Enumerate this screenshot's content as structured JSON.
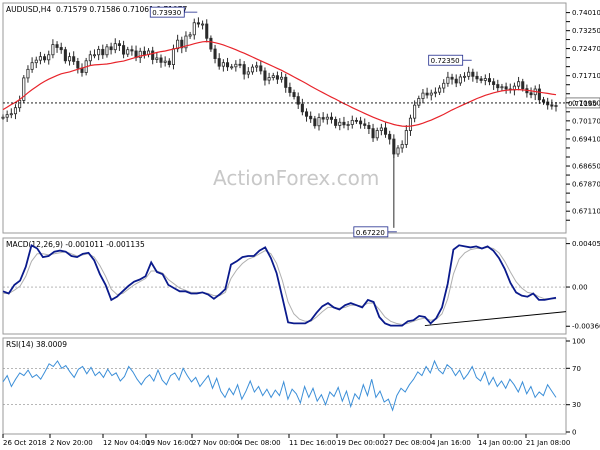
{
  "header": {
    "symbol": "AUDUSD,H4",
    "ohlc": "0.71579 0.71586 0.71061 0.71077"
  },
  "watermark": "ActionForex.com",
  "colors": {
    "candle": "#2b2b2b",
    "ma": "#e8242b",
    "macd": "#0a1a8c",
    "signal": "#b0b0b0",
    "rsi": "#3c8fd8",
    "grid": "#8c8c8c"
  },
  "chart_data": [
    {
      "type": "candlestick",
      "name": "price",
      "title": "AUDUSD,H4",
      "ylim": [
        0.6712,
        0.7425
      ],
      "y_ticks": [
        0.7401,
        0.73725,
        0.7344,
        0.7316,
        0.72875,
        0.7259,
        0.72305,
        0.7202,
        0.71735,
        0.7145,
        0.71165,
        0.7088,
        0.70595,
        0.7031,
        0.70025,
        0.6974,
        0.69455,
        0.6917,
        0.68885,
        0.686,
        0.68315,
        0.6803,
        0.67745,
        0.6746
      ],
      "y_tick_labels": [
        "0.74010",
        "",
        "0.73250",
        "",
        "0.72470",
        "",
        "",
        "0.71710",
        "",
        "",
        "0.70950",
        "",
        "0.70170",
        "",
        "0.69410",
        "",
        "",
        "0.68650",
        "",
        "0.67870",
        "",
        "",
        "0.67110"
      ],
      "current_price": 0.7116,
      "current_price_label": "0.71160",
      "annotations": [
        {
          "label": "0.73930",
          "value": 0.7393
        },
        {
          "label": "0.72350",
          "value": 0.7235
        },
        {
          "label": "0.67220",
          "value": 0.6722
        }
      ],
      "close_path": [
        0.7071,
        0.7079,
        0.7082,
        0.7101,
        0.7124,
        0.7195,
        0.7222,
        0.7243,
        0.7251,
        0.7262,
        0.7252,
        0.7268,
        0.73,
        0.7291,
        0.7284,
        0.7249,
        0.7262,
        0.7247,
        0.7226,
        0.7212,
        0.7249,
        0.7268,
        0.7268,
        0.7285,
        0.7268,
        0.7293,
        0.7284,
        0.7303,
        0.7297,
        0.727,
        0.7284,
        0.728,
        0.7259,
        0.7279,
        0.7269,
        0.728,
        0.7253,
        0.7258,
        0.7244,
        0.7248,
        0.7237,
        0.7287,
        0.7314,
        0.729,
        0.7327,
        0.7331,
        0.7369,
        0.7365,
        0.7365,
        0.732,
        0.7286,
        0.7256,
        0.7232,
        0.7243,
        0.723,
        0.723,
        0.7238,
        0.7237,
        0.7207,
        0.7214,
        0.7229,
        0.7233,
        0.7217,
        0.7188,
        0.7196,
        0.7202,
        0.7191,
        0.7197,
        0.7165,
        0.7149,
        0.7136,
        0.7112,
        0.7088,
        0.7074,
        0.7066,
        0.7044,
        0.707,
        0.7065,
        0.7071,
        0.7064,
        0.7045,
        0.7055,
        0.7047,
        0.7048,
        0.7061,
        0.7059,
        0.705,
        0.7045,
        0.7035,
        0.7006,
        0.7029,
        0.7037,
        0.7017,
        0.7002,
        0.6955,
        0.6974,
        0.6985,
        0.7029,
        0.7068,
        0.7109,
        0.713,
        0.7147,
        0.7141,
        0.7147,
        0.715,
        0.7163,
        0.7178,
        0.7197,
        0.7191,
        0.7179,
        0.7198,
        0.72,
        0.7213,
        0.72,
        0.7192,
        0.7187,
        0.7193,
        0.7183,
        0.7174,
        0.7164,
        0.7167,
        0.716,
        0.7157,
        0.7169,
        0.7183,
        0.7161,
        0.7148,
        0.7142,
        0.716,
        0.7126,
        0.7119,
        0.711,
        0.7106,
        0.7108
      ],
      "ma_path": [
        0.7095,
        0.7103,
        0.7111,
        0.7118,
        0.7127,
        0.7137,
        0.7148,
        0.7158,
        0.7167,
        0.7176,
        0.7184,
        0.7191,
        0.7197,
        0.7203,
        0.7208,
        0.7211,
        0.7214,
        0.7218,
        0.7222,
        0.7226,
        0.723,
        0.7234,
        0.7236,
        0.7237,
        0.7238,
        0.7239,
        0.7241,
        0.7244,
        0.7246,
        0.7248,
        0.7252,
        0.7256,
        0.726,
        0.7264,
        0.7266,
        0.7269,
        0.7272,
        0.7275,
        0.7278,
        0.728,
        0.7283,
        0.7286,
        0.7289,
        0.7292,
        0.7296,
        0.7299,
        0.7303,
        0.7306,
        0.7309,
        0.731,
        0.7309,
        0.7306,
        0.7303,
        0.7299,
        0.7294,
        0.7289,
        0.7284,
        0.7278,
        0.7273,
        0.7267,
        0.7261,
        0.7255,
        0.7249,
        0.7243,
        0.7237,
        0.7231,
        0.7225,
        0.7219,
        0.7212,
        0.7205,
        0.7198,
        0.7191,
        0.7184,
        0.7177,
        0.7169,
        0.7162,
        0.7155,
        0.7148,
        0.7141,
        0.7134,
        0.7128,
        0.7121,
        0.7114,
        0.7108,
        0.7101,
        0.7095,
        0.7089,
        0.7083,
        0.7077,
        0.7071,
        0.7066,
        0.7061,
        0.7056,
        0.7052,
        0.7048,
        0.7045,
        0.7043,
        0.7042,
        0.7043,
        0.7045,
        0.7048,
        0.7052,
        0.7057,
        0.7062,
        0.7068,
        0.7074,
        0.708,
        0.7087,
        0.7094,
        0.71,
        0.7106,
        0.7112,
        0.7118,
        0.7124,
        0.713,
        0.7135,
        0.714,
        0.7144,
        0.7148,
        0.7151,
        0.7154,
        0.7156,
        0.7157,
        0.7158,
        0.7158,
        0.7157,
        0.7156,
        0.7154,
        0.7152,
        0.715,
        0.7148,
        0.7146,
        0.7144,
        0.7142
      ],
      "spike_low": 0.6722
    },
    {
      "type": "line",
      "name": "macd",
      "title": "MACD(12,26,9) -0.001011 -0.001135",
      "ylim": [
        -0.0042,
        0.0043
      ],
      "y_ticks": [
        0.004055,
        0.0,
        -0.003662
      ],
      "y_tick_labels": [
        "0.004055",
        "0.00",
        "-0.003662"
      ],
      "series": [
        {
          "name": "MACD",
          "values": [
            -0.0004,
            -0.0006,
            0.0002,
            0.0006,
            0.0019,
            0.0039,
            0.0036,
            0.0028,
            0.0029,
            0.0033,
            0.0034,
            0.0033,
            0.0029,
            0.0028,
            0.0031,
            0.0032,
            0.0025,
            0.0012,
            0.0002,
            -0.0012,
            -0.0009,
            -0.0004,
            0.0001,
            0.0005,
            0.0007,
            0.001,
            0.0023,
            0.0014,
            0.0012,
            0.0002,
            -0.0001,
            -0.0004,
            -0.0004,
            -0.0006,
            -0.0006,
            -0.0005,
            -0.0007,
            -0.0011,
            -0.0007,
            -0.0002,
            0.0021,
            0.0024,
            0.0028,
            0.0029,
            0.0029,
            0.0034,
            0.0037,
            0.0027,
            0.0013,
            -0.001,
            -0.0033,
            -0.0034,
            -0.0034,
            -0.0034,
            -0.0031,
            -0.0024,
            -0.0018,
            -0.0015,
            -0.0019,
            -0.0021,
            -0.0017,
            -0.0015,
            -0.0017,
            -0.0019,
            -0.0012,
            -0.0014,
            -0.0028,
            -0.0034,
            -0.0036,
            -0.0036,
            -0.0036,
            -0.0032,
            -0.0031,
            -0.0027,
            -0.0028,
            -0.0034,
            -0.0029,
            -0.0019,
            0.0003,
            0.0035,
            0.0039,
            0.0038,
            0.0037,
            0.0038,
            0.0036,
            0.0038,
            0.0034,
            0.0027,
            0.0017,
            0.0004,
            -0.0005,
            -0.0008,
            -0.0009,
            -0.0006,
            -0.0012,
            -0.0012,
            -0.0011,
            -0.001
          ]
        },
        {
          "name": "Signal",
          "values": [
            -0.0006,
            -0.0006,
            -0.0003,
            0.0001,
            0.001,
            0.0024,
            0.0031,
            0.0031,
            0.003,
            0.0031,
            0.0032,
            0.0033,
            0.0031,
            0.0029,
            0.003,
            0.0031,
            0.0028,
            0.002,
            0.001,
            -0.0002,
            -0.0007,
            -0.0006,
            -0.0002,
            0.0002,
            0.0005,
            0.0008,
            0.0015,
            0.0015,
            0.0013,
            0.0007,
            0.0003,
            -0.0001,
            -0.0003,
            -0.0005,
            -0.0005,
            -0.0005,
            -0.0006,
            -0.0008,
            -0.0008,
            -0.0005,
            0.0008,
            0.0016,
            0.0022,
            0.0026,
            0.0028,
            0.0031,
            0.0034,
            0.0031,
            0.0022,
            0.0006,
            -0.0014,
            -0.0025,
            -0.003,
            -0.0032,
            -0.0032,
            -0.0028,
            -0.0023,
            -0.0019,
            -0.0019,
            -0.002,
            -0.0019,
            -0.0017,
            -0.0017,
            -0.0018,
            -0.0015,
            -0.0015,
            -0.0021,
            -0.0028,
            -0.0032,
            -0.0034,
            -0.0035,
            -0.0034,
            -0.0032,
            -0.003,
            -0.0029,
            -0.0031,
            -0.003,
            -0.0025,
            -0.0011,
            0.0012,
            0.0026,
            0.0032,
            0.0035,
            0.0036,
            0.0036,
            0.0037,
            0.0036,
            0.0032,
            0.0024,
            0.0014,
            0.0005,
            -0.0001,
            -0.0005,
            -0.0006,
            -0.0009,
            -0.0011,
            -0.0011,
            -0.0011
          ]
        }
      ],
      "trendline": [
        [
          74,
          -0.0036
        ],
        [
          112,
          -0.0016
        ]
      ]
    },
    {
      "type": "line",
      "name": "rsi",
      "title": "RSI(14) 38.0009",
      "ylim": [
        0,
        100
      ],
      "y_ticks": [
        100,
        70,
        30,
        0
      ],
      "y_tick_labels": [
        "100",
        "70",
        "30",
        "0"
      ],
      "series": [
        {
          "name": "RSI",
          "values": [
            55,
            62,
            50,
            58,
            65,
            62,
            68,
            60,
            63,
            58,
            66,
            75,
            72,
            78,
            70,
            73,
            66,
            60,
            69,
            72,
            64,
            71,
            62,
            66,
            60,
            69,
            62,
            65,
            56,
            61,
            72,
            66,
            58,
            52,
            59,
            63,
            56,
            68,
            57,
            52,
            62,
            65,
            57,
            70,
            62,
            55,
            60,
            50,
            56,
            62,
            48,
            59,
            45,
            38,
            48,
            41,
            52,
            36,
            45,
            56,
            44,
            50,
            40,
            47,
            38,
            46,
            40,
            55,
            36,
            47,
            42,
            32,
            50,
            38,
            48,
            34,
            41,
            30,
            44,
            39,
            49,
            34,
            45,
            28,
            42,
            36,
            52,
            40,
            58,
            38,
            45,
            33,
            36,
            24,
            40,
            48,
            44,
            52,
            58,
            66,
            62,
            72,
            65,
            78,
            68,
            64,
            74,
            70,
            62,
            68,
            58,
            64,
            72,
            60,
            56,
            66,
            52,
            60,
            50,
            56,
            48,
            58,
            52,
            44,
            55,
            42,
            50,
            38,
            44,
            40,
            52,
            45,
            38
          ]
        }
      ]
    }
  ],
  "x_axis": {
    "tick_labels": [
      "26 Oct 2018",
      "2 Nov 20:00",
      "12 Nov 04:00",
      "19 Nov 16:00",
      "27 Nov 00:00",
      "4 Dec 08:00",
      "11 Dec 16:00",
      "19 Dec 00:00",
      "27 Dec 08:00",
      "4 Jan 16:00",
      "14 Jan 00:00",
      "21 Jan 08:00"
    ]
  }
}
